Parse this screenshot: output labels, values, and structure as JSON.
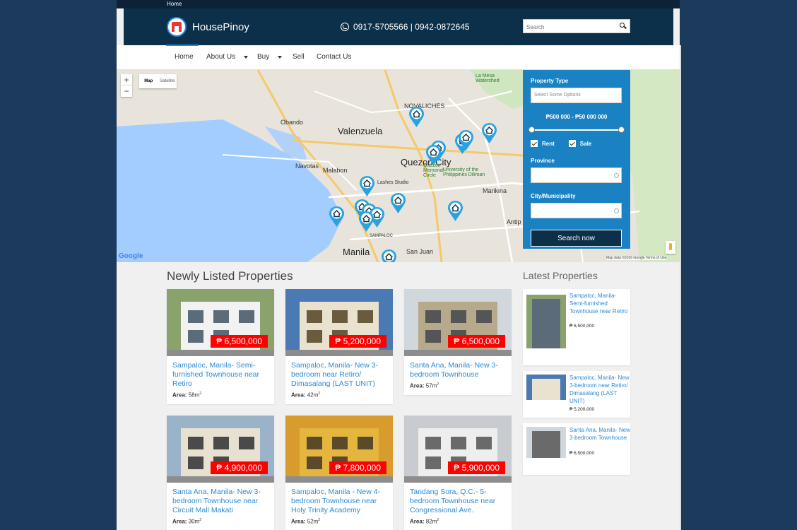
{
  "topbar": {
    "home_link": "Home"
  },
  "header": {
    "brand": "HousePinoy",
    "phone": "0917-5705566 | 0942-0872645",
    "search_placeholder": "Search"
  },
  "nav": {
    "items": [
      {
        "label": "Home",
        "dropdown": false
      },
      {
        "label": "About Us",
        "dropdown": true
      },
      {
        "label": "Buy",
        "dropdown": true
      },
      {
        "label": "Sell",
        "dropdown": false
      },
      {
        "label": "Contact Us",
        "dropdown": false
      }
    ]
  },
  "map": {
    "zoom_in": "+",
    "zoom_out": "−",
    "type_map": "Map",
    "type_satellite": "Satellite",
    "google": "Google",
    "credit": "Map data ©2016 Google    Terms of Use",
    "places": {
      "novaliches": "NOVALICHES",
      "valenzuela": "Valenzuela",
      "obando": "Obando",
      "navotas": "Navotas",
      "malabon": "Malabon",
      "quezon_city": "Quezon City",
      "marikina": "Marikina",
      "manila": "Manila",
      "san_juan": "San Juan",
      "antipolo": "Antip",
      "la_mesa": "La Mesa Watershed",
      "lashes": "Lashes Studio",
      "up": "University of the Philippines Diliman",
      "qc_circle": "Quezon Memorial Circle",
      "sampaloc": "SAMPALOC"
    }
  },
  "filter": {
    "property_type_label": "Property Type",
    "property_type_placeholder": "Select Some Options",
    "price_range": "₱500 000 - ₱50 000 000",
    "rent_label": "Rent",
    "sale_label": "Sale",
    "province_label": "Province",
    "city_label": "City/Municipality",
    "search_button": "Search now"
  },
  "newly_listed": {
    "title": "Newly Listed Properties",
    "area_label": "Area:",
    "area_unit": "m",
    "area_exp": "2",
    "cards": [
      {
        "price": "₱ 6,500,000",
        "title": "Sampaloc, Manila- Semi-furnished Townhouse near Retiro",
        "area": "58",
        "palette": [
          "#8aa36c",
          "#f2f2f2",
          "#5c6b7a"
        ]
      },
      {
        "price": "₱ 5,200,000",
        "title": "Sampaloc, Manila- New 3-bedroom near Retiro/ Dimasalang (LAST UNIT)",
        "area": "42",
        "palette": [
          "#4b79b3",
          "#e8e2cf",
          "#6b5b3e"
        ]
      },
      {
        "price": "₱ 6,500,000",
        "title": "Santa Ana, Manila- New 3-bedroom Townhouse",
        "area": "57",
        "palette": [
          "#d0d8de",
          "#b7a98c",
          "#555555"
        ]
      },
      {
        "price": "₱ 4,900,000",
        "title": "Santa Ana, Manila- New 3-bedroom Townhouse near Circuit Mall Makati",
        "area": "30",
        "palette": [
          "#9bb3c9",
          "#e8e1d2",
          "#4a4a4a"
        ]
      },
      {
        "price": "₱ 7,800,000",
        "title": "Sampaloc, Manila - New 4-bedroom Townhouse near Holy Trinity Academy",
        "area": "52",
        "palette": [
          "#d79b2e",
          "#e5b63d",
          "#5b4a2a"
        ]
      },
      {
        "price": "₱ 5,900,000",
        "title": "Tandang Sora, Q.C.- 5-bedroom Townhouse near Congressional Ave.",
        "area": "82",
        "palette": [
          "#c8ccd0",
          "#eeeeee",
          "#6a6a6a"
        ]
      }
    ]
  },
  "latest": {
    "title": "Latest Properties",
    "items": [
      {
        "title": "Sampaloc, Manila- Semi-furnished Townhouse near Retiro",
        "price": "₱ 6,500,000"
      },
      {
        "title": "Sampaloc, Manila- New 3-bedroom near Retiro/ Dimasalang (LAST UNIT)",
        "price": "₱ 5,200,000"
      },
      {
        "title": "Santa Ana, Manila- New 3-bedroom Townhouse",
        "price": "₱ 6,500,000"
      }
    ]
  }
}
